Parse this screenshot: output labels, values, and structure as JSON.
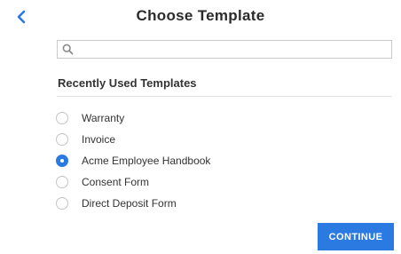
{
  "header": {
    "title": "Choose Template",
    "back_icon": "chevron-left-icon"
  },
  "search": {
    "icon": "search-icon",
    "value": "",
    "placeholder": ""
  },
  "templates": {
    "heading": "Recently Used Templates",
    "options": [
      {
        "label": "Warranty",
        "selected": false
      },
      {
        "label": "Invoice",
        "selected": false
      },
      {
        "label": "Acme Employee Handbook",
        "selected": true
      },
      {
        "label": "Consent Form",
        "selected": false
      },
      {
        "label": "Direct Deposit Form",
        "selected": false
      }
    ]
  },
  "actions": {
    "continue_label": "CONTINUE"
  },
  "colors": {
    "accent": "#2a7ae2",
    "text": "#333333",
    "border": "#c9c9c9"
  }
}
